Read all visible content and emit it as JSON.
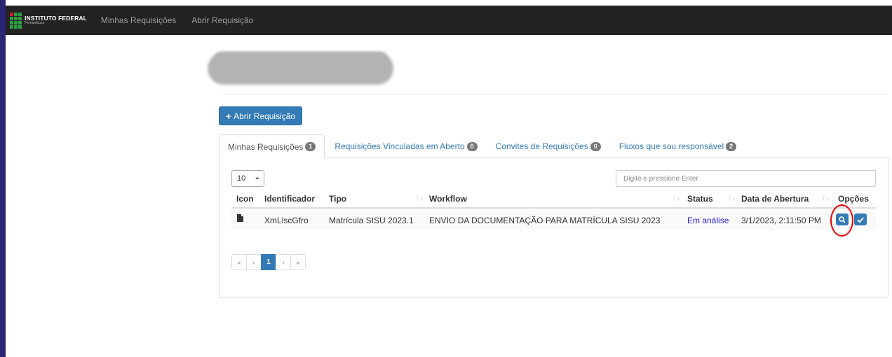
{
  "navbar": {
    "logo_main": "INSTITUTO FEDERAL",
    "logo_sub": "Pernambuco",
    "links": [
      "Minhas Requisições",
      "Abrir Requisição"
    ]
  },
  "toolbar": {
    "new_request_label": "Abrir Requisição"
  },
  "tabs": [
    {
      "label": "Minhas Requisições",
      "count": "1"
    },
    {
      "label": "Requisições Vinculadas em Aberto",
      "count": "0"
    },
    {
      "label": "Convites de Requisições",
      "count": "0"
    },
    {
      "label": "Fluxos que sou responsável",
      "count": "2"
    }
  ],
  "table": {
    "page_size": "10",
    "search_placeholder": "Digite e pressione Enter",
    "headers": [
      "Icon",
      "Identificador",
      "Tipo",
      "Workflow",
      "Status",
      "Data de Abertura",
      "Opções"
    ],
    "rows": [
      {
        "icon": "file-icon",
        "identificador": "XmLlscGfro",
        "tipo": "Matrícula SISU 2023.1",
        "workflow": "ENVIO DA DOCUMENTAÇÃO PARA MATRÍCULA SISU 2023",
        "status": "Em análise",
        "data": "3/1/2023, 2:11:50 PM"
      }
    ]
  },
  "pagination": {
    "first": "«",
    "prev": "‹",
    "current": "1",
    "next": "›",
    "last": "»"
  },
  "colors": {
    "primary": "#337ab7",
    "navbar": "#222222",
    "frame": "#2a2575",
    "highlight": "#ee0000"
  }
}
